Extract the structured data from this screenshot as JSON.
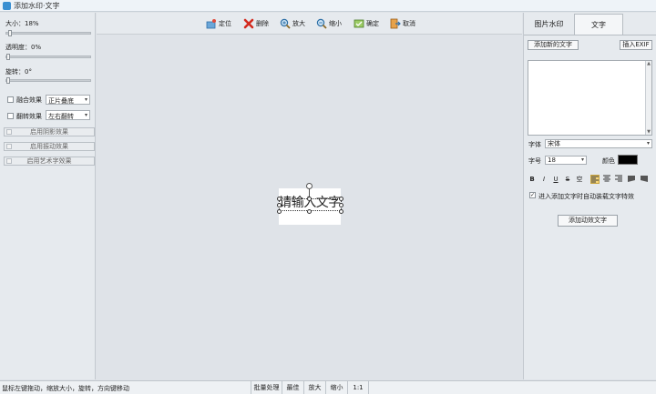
{
  "window": {
    "title": "添加水印·文字"
  },
  "left_panel": {
    "size_label": "大小：18%",
    "size_value": 18,
    "opacity_label": "透明度：0%",
    "opacity_value": 0,
    "rotation_label": "旋转：0°",
    "rotation_value": 0,
    "blend_label": "融合效果",
    "blend_value": "正片叠底",
    "flip_label": "翻转效果",
    "flip_value": "左右翻转",
    "effects": [
      "启用阴影效果",
      "启用振动效果",
      "启用艺术字效果"
    ]
  },
  "toolbar": {
    "position": "定位",
    "delete": "删除",
    "zoom_in": "放大",
    "zoom_out": "缩小",
    "confirm": "确定",
    "cancel": "取消"
  },
  "canvas": {
    "watermark_text": "请输入文字"
  },
  "right_panel": {
    "tabs": [
      "图片水印",
      "文字"
    ],
    "active_tab": "文字",
    "add_text_button": "添加新的文字",
    "insert_exif_button": "插入EXIF",
    "text_value": "",
    "font_label": "字体",
    "font_value": "宋体",
    "size_label": "字号",
    "size_value": "18",
    "color_label": "颜色",
    "color_value": "#000000",
    "format_buttons": [
      "B",
      "I",
      "U",
      "S",
      "空"
    ],
    "auto_effect_label": "进入添加文字时自动装载文字特效",
    "auto_effect_checked": true,
    "add_animated_button": "添加动效文字"
  },
  "statusbar": {
    "hint": "鼠标左键拖动，缩放大小，旋转，方向键移动",
    "batch": "批量处理",
    "best": "最佳",
    "zoom_in": "放大",
    "zoom_out": "缩小",
    "ratio": "1:1"
  }
}
